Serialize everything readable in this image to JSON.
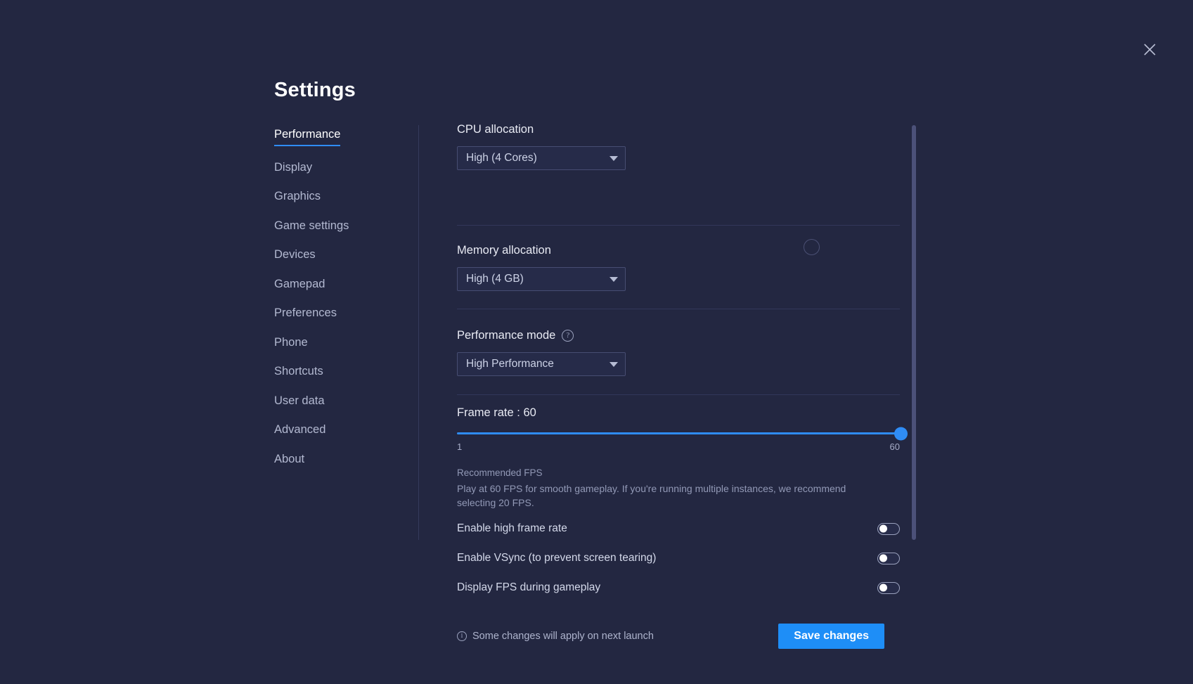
{
  "window": {
    "title": "Settings",
    "close_icon": "close-icon"
  },
  "sidebar": {
    "items": [
      {
        "label": "Performance",
        "active": true
      },
      {
        "label": "Display",
        "active": false
      },
      {
        "label": "Graphics",
        "active": false
      },
      {
        "label": "Game settings",
        "active": false
      },
      {
        "label": "Devices",
        "active": false
      },
      {
        "label": "Gamepad",
        "active": false
      },
      {
        "label": "Preferences",
        "active": false
      },
      {
        "label": "Phone",
        "active": false
      },
      {
        "label": "Shortcuts",
        "active": false
      },
      {
        "label": "User data",
        "active": false
      },
      {
        "label": "Advanced",
        "active": false
      },
      {
        "label": "About",
        "active": false
      }
    ]
  },
  "main": {
    "cpu": {
      "label": "CPU allocation",
      "value": "High (4 Cores)",
      "caret_icon": "chevron-down-icon"
    },
    "memory": {
      "label": "Memory allocation",
      "value": "High (4 GB)",
      "caret_icon": "chevron-down-icon"
    },
    "spinner_icon": "loading-spinner-icon",
    "performance_mode": {
      "label": "Performance mode",
      "help_icon": "help-icon",
      "help_glyph": "?",
      "value": "High Performance",
      "caret_icon": "chevron-down-icon"
    },
    "frame_rate": {
      "label": "Frame rate : 60",
      "value": 60,
      "min": 1,
      "max": 60,
      "min_label": "1",
      "max_label": "60",
      "thumb_label": "60"
    },
    "recommendation": {
      "title": "Recommended FPS",
      "body": "Play at 60 FPS for smooth gameplay. If you're running multiple instances, we recommend selecting 20 FPS."
    },
    "toggles": [
      {
        "label": "Enable high frame rate",
        "on": false
      },
      {
        "label": "Enable VSync (to prevent screen tearing)",
        "on": false
      },
      {
        "label": "Display FPS during gameplay",
        "on": false
      }
    ],
    "footer": {
      "info_icon": "info-icon",
      "info_glyph": "i",
      "note": "Some changes will apply on next launch",
      "save_label": "Save changes"
    }
  },
  "colors": {
    "background": "#232741",
    "accent": "#2f8cf5",
    "save_button": "#1e8ef7",
    "text_primary": "#ffffff",
    "text_muted": "#9299b6"
  }
}
